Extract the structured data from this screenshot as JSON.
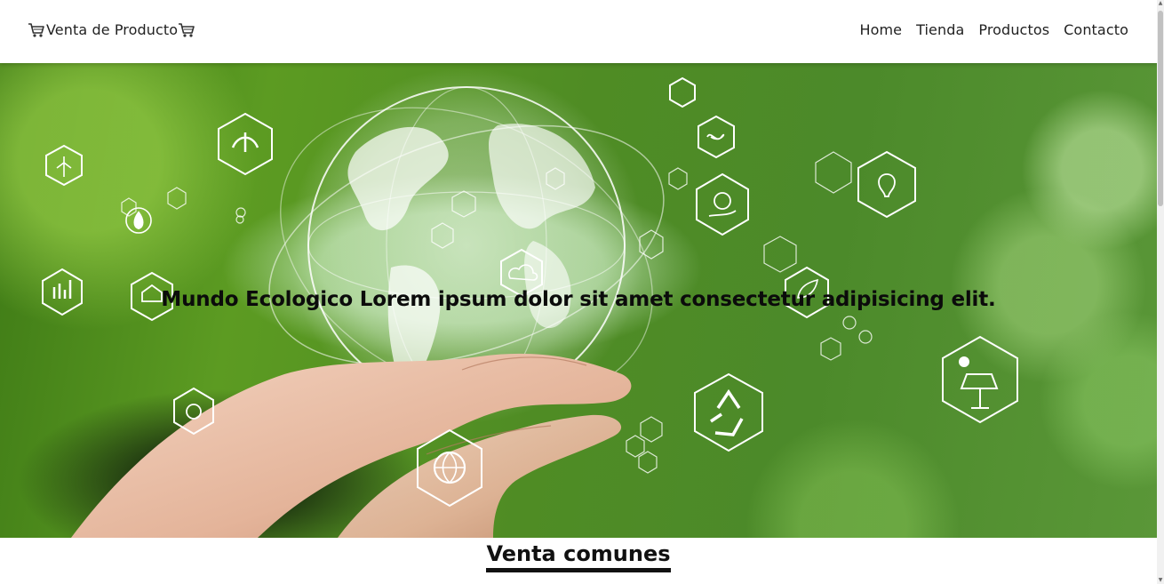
{
  "header": {
    "brand": "Venta de Producto",
    "brand_icon": "shopping-cart-icon",
    "nav": [
      "Home",
      "Tienda",
      "Productos",
      "Contacto"
    ]
  },
  "hero": {
    "title": "Mundo Ecologico Lorem ipsum dolor sit amet consectetur adipisicing elit.",
    "image": "hands-holding-globe-with-eco-icons"
  },
  "section": {
    "title": "Venta comunes"
  },
  "colors": {
    "header_bg": "#ffffff",
    "hero_green": "#4f8c24",
    "text_dark": "#111111"
  },
  "scrollbar": {
    "icon_up": "▲",
    "icon_down": "▼"
  }
}
